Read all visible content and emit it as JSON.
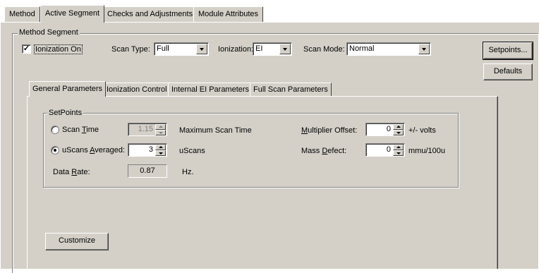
{
  "tabs": [
    {
      "label": "Method",
      "active": false
    },
    {
      "label": "Active Segment",
      "active": true
    },
    {
      "label": "Checks and Adjustments",
      "active": false
    },
    {
      "label": "Module Attributes",
      "active": false
    }
  ],
  "segment": {
    "group_label": "Method Segment",
    "ionization_on": {
      "label": "Ionization On",
      "checked": true
    },
    "scan_type": {
      "label": "Scan Type:",
      "value": "Full"
    },
    "ionization": {
      "label": "Ionization:",
      "value": "EI"
    },
    "scan_mode": {
      "label": "Scan Mode:",
      "value": "Normal"
    },
    "setpoints_button": "Setpoints...",
    "defaults_button": "Defaults"
  },
  "subtabs": [
    {
      "label": "General Parameters",
      "active": true
    },
    {
      "label": "Ionization Control",
      "active": false
    },
    {
      "label": "Internal EI Parameters",
      "active": false
    },
    {
      "label": "Full Scan Parameters",
      "active": false
    }
  ],
  "setpoints": {
    "group_label": "SetPoints",
    "scan_time": {
      "label_pre": "Scan ",
      "label_key": "T",
      "label_post": "ime",
      "value": "1.15",
      "selected": false,
      "suffix": "Maximum Scan Time"
    },
    "uscans": {
      "label_pre": "uScans ",
      "label_key": "A",
      "label_post": "veraged:",
      "value": "3",
      "selected": true,
      "suffix": "uScans"
    },
    "data_rate": {
      "label_pre": "Data ",
      "label_key": "R",
      "label_post": "ate:",
      "value": "0.87",
      "suffix": "Hz."
    },
    "multiplier_offset": {
      "label_pre": "",
      "label_key": "M",
      "label_post": "ultiplier Offset:",
      "value": "0",
      "suffix": "+/- volts"
    },
    "mass_defect": {
      "label_pre": "Mass ",
      "label_key": "D",
      "label_post": "efect:",
      "value": "0",
      "suffix": "mmu/100u"
    }
  },
  "customize_button": "Customize"
}
